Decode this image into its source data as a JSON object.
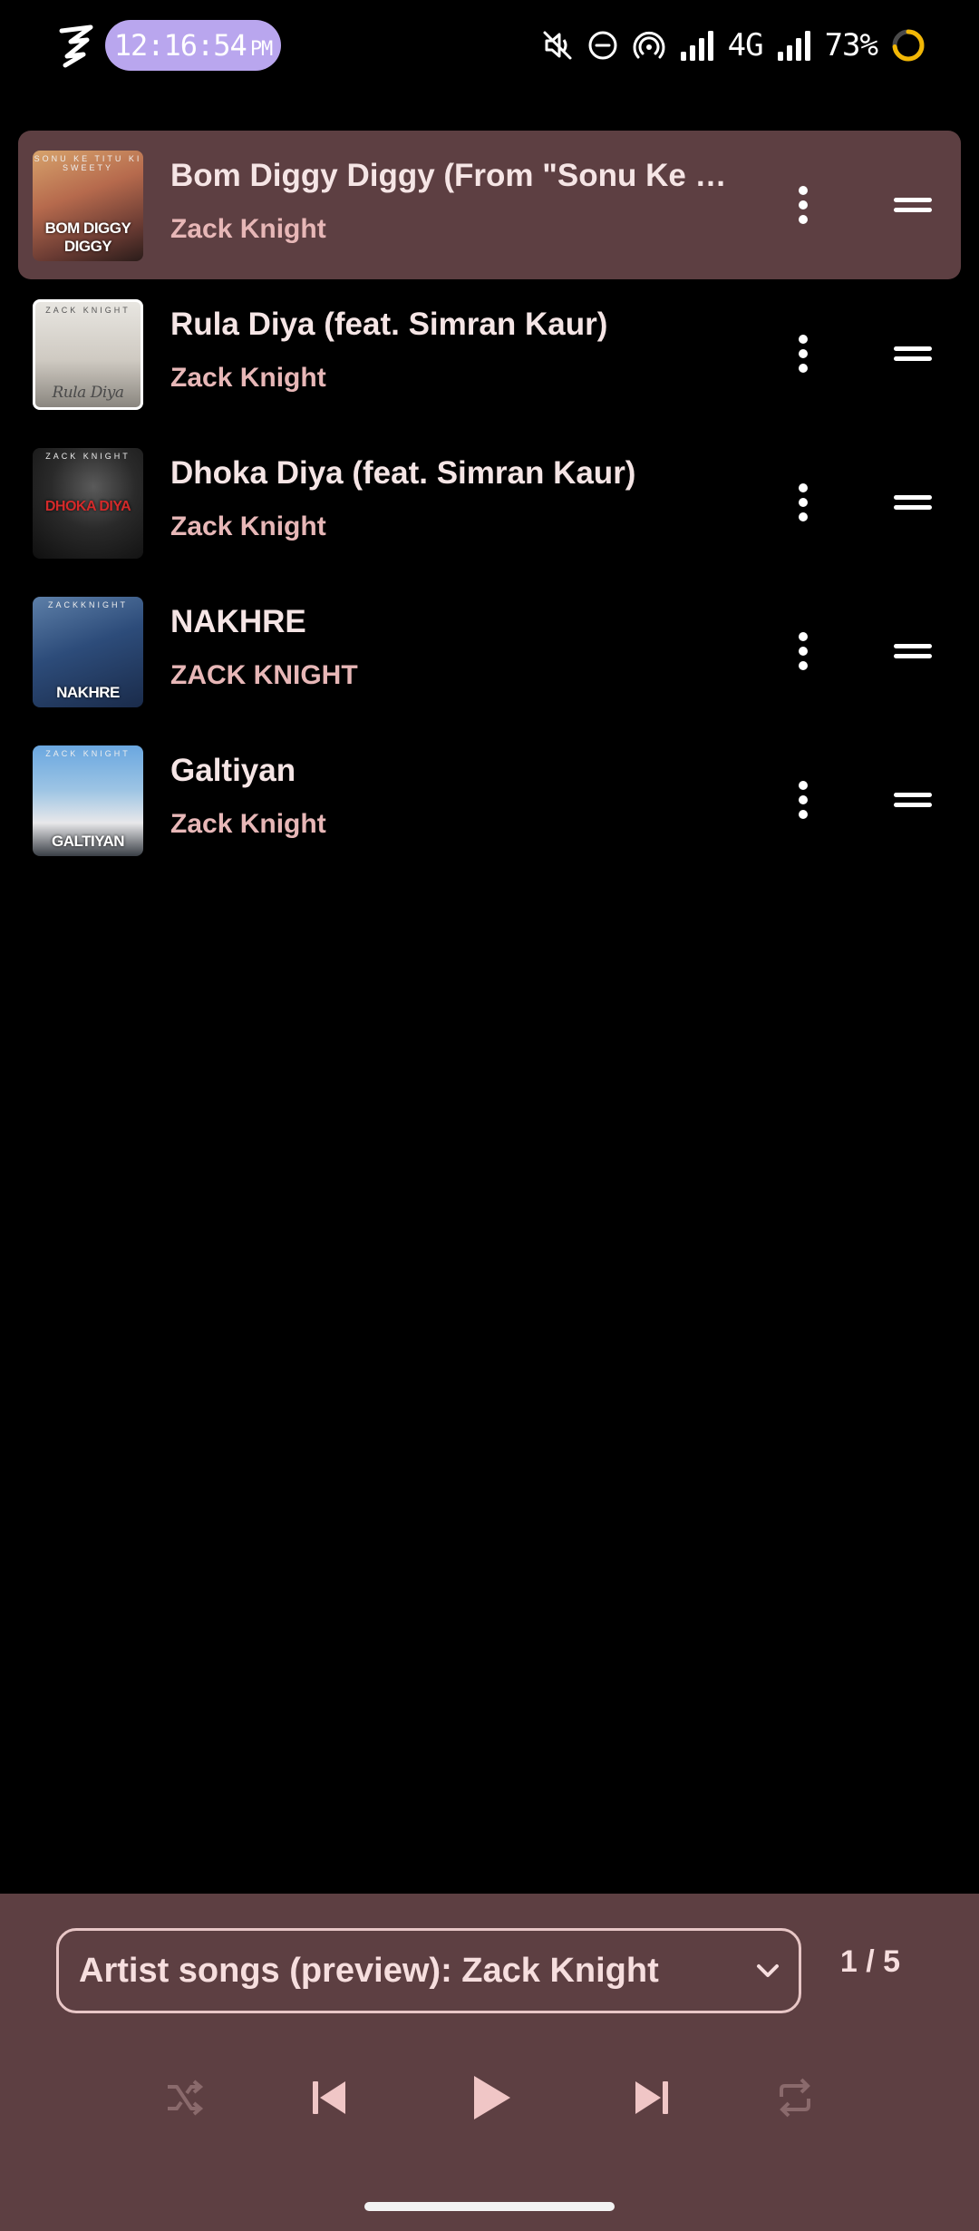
{
  "status_bar": {
    "time": "12:16:54",
    "ampm": "PM",
    "network": "4G",
    "battery": "73%",
    "icons": [
      "app-logo-icon",
      "mute-icon",
      "do-not-disturb-icon",
      "hotspot-icon",
      "signal-icon",
      "signal-icon-2",
      "battery-ring-icon"
    ],
    "colors": {
      "time_pill": "#b9a6ee",
      "battery_ring": "#f2b705"
    }
  },
  "queue": {
    "items": [
      {
        "title": "Bom Diggy Diggy (From \"Sonu Ke …",
        "artist": "Zack Knight",
        "thumb_caption": "BOM DIGGY DIGGY",
        "thumb_top": "SONU KE TITU KI SWEETY",
        "current": true
      },
      {
        "title": "Rula Diya (feat. Simran Kaur)",
        "artist": "Zack Knight",
        "thumb_caption": "Rula Diya",
        "thumb_top": "ZACK KNIGHT",
        "current": false
      },
      {
        "title": "Dhoka Diya (feat. Simran Kaur)",
        "artist": "Zack Knight",
        "thumb_caption": "DHOKA DIYA",
        "thumb_top": "ZACK KNIGHT",
        "current": false
      },
      {
        "title": "NAKHRE",
        "artist": "ZACK KNIGHT",
        "thumb_caption": "NAKHRE",
        "thumb_top": "ZACKKNIGHT",
        "current": false
      },
      {
        "title": "Galtiyan",
        "artist": "Zack Knight",
        "thumb_caption": "GALTIYAN",
        "thumb_top": "ZACK KNIGHT",
        "current": false
      }
    ],
    "row_icons": {
      "more": "more-vertical-icon",
      "drag": "drag-handle-icon"
    },
    "colors": {
      "current_row_bg": "#5d3f42",
      "title": "#f5e5e5",
      "artist": "#e7b7b7"
    }
  },
  "player": {
    "queue_label": "Artist songs (preview): Zack Knight",
    "position": "1 / 5",
    "controls": {
      "shuffle": "shuffle-icon",
      "previous": "skip-previous-icon",
      "play": "play-icon",
      "next": "skip-next-icon",
      "repeat": "repeat-icon"
    },
    "colors": {
      "panel_bg": "#5d3f42",
      "accent": "#f0c6c6",
      "disabled": "#8a6a6c"
    }
  }
}
